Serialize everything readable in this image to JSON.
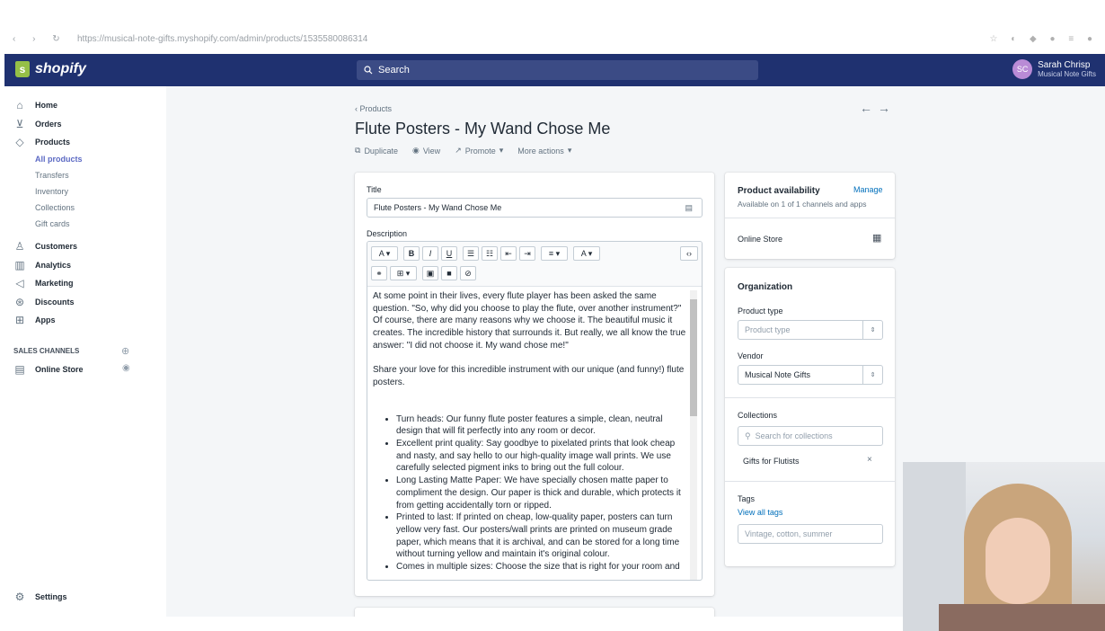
{
  "browser": {
    "nav_glyphs": "‹ › ↻",
    "url": "https://musical-note-gifts.myshopify.com/admin/products/1535580086314",
    "ext_glyphs": "☆ ◐ ◆ ● ≡ ●"
  },
  "topbar": {
    "logo_text": "shopify",
    "search_placeholder": "Search",
    "user_initials": "SC",
    "user_name": "Sarah Chrisp",
    "store_name": "Musical Note Gifts"
  },
  "sidebar": {
    "items": [
      {
        "label": "Home",
        "icon": "home-icon",
        "glyph": "⌂"
      },
      {
        "label": "Orders",
        "icon": "orders-icon",
        "glyph": "⊻"
      },
      {
        "label": "Products",
        "icon": "tag-icon",
        "glyph": "◇"
      },
      {
        "label": "Customers",
        "icon": "person-icon",
        "glyph": "♙"
      },
      {
        "label": "Analytics",
        "icon": "bar-chart-icon",
        "glyph": "▥"
      },
      {
        "label": "Marketing",
        "icon": "megaphone-icon",
        "glyph": "◁"
      },
      {
        "label": "Discounts",
        "icon": "discount-icon",
        "glyph": "⊛"
      },
      {
        "label": "Apps",
        "icon": "apps-icon",
        "glyph": "⊞"
      }
    ],
    "sub_items": [
      "All products",
      "Transfers",
      "Inventory",
      "Collections",
      "Gift cards"
    ],
    "sales_channels_label": "SALES CHANNELS",
    "online_store_label": "Online Store",
    "settings_label": "Settings"
  },
  "page": {
    "breadcrumb": "Products",
    "title": "Flute Posters - My Wand Chose Me",
    "actions": {
      "duplicate": "Duplicate",
      "view": "View",
      "promote": "Promote",
      "more": "More actions"
    }
  },
  "form": {
    "title_label": "Title",
    "title_value": "Flute Posters - My Wand Chose Me",
    "description_label": "Description",
    "description_paragraphs": [
      "At some point in their lives, every flute player has been asked the same question. \"So, why did you choose to play the flute, over another instrument?\" Of course, there are many reasons why we choose it. The beautiful music it creates. The incredible history that surrounds it. But really, we all know the true answer: \"I did not choose it. My wand chose me!\"",
      "Share your love for this incredible instrument with our unique (and funny!) flute posters."
    ],
    "description_bullets": [
      "Turn heads: Our funny flute poster features a simple, clean, neutral design that will fit perfectly into any room or decor.",
      "Excellent print quality: Say goodbye to pixelated prints that look cheap and nasty, and say hello to our high-quality image wall prints. We use carefully selected pigment inks to bring out the full colour.",
      "Long Lasting Matte Paper: We have specially chosen matte paper to compliment the design. Our paper is thick and durable, which protects it from getting accidentally torn or ripped.",
      "Printed to last: If printed on cheap, low-quality paper, posters can turn yellow very fast. Our posters/wall prints are printed on museum grade paper, which means that it is archival, and can be stored for a long time without turning yellow and maintain it's original colour.",
      "Comes in multiple sizes: Choose the size that is right for your room and"
    ]
  },
  "availability": {
    "heading": "Product availability",
    "manage": "Manage",
    "subtext": "Available on 1 of 1 channels and apps",
    "channel": "Online Store"
  },
  "organization": {
    "heading": "Organization",
    "product_type_label": "Product type",
    "product_type_placeholder": "Product type",
    "vendor_label": "Vendor",
    "vendor_value": "Musical Note Gifts",
    "collections_label": "Collections",
    "collections_placeholder": "Search for collections",
    "collection_chip": "Gifts for Flutists",
    "tags_label": "Tags",
    "view_all_tags": "View all tags",
    "tags_placeholder": "Vintage, cotton, summer"
  },
  "colors": {
    "topbar": "#1f3170",
    "accent": "#5c6ac4",
    "link": "#006fbb",
    "background": "#f4f6f8"
  }
}
